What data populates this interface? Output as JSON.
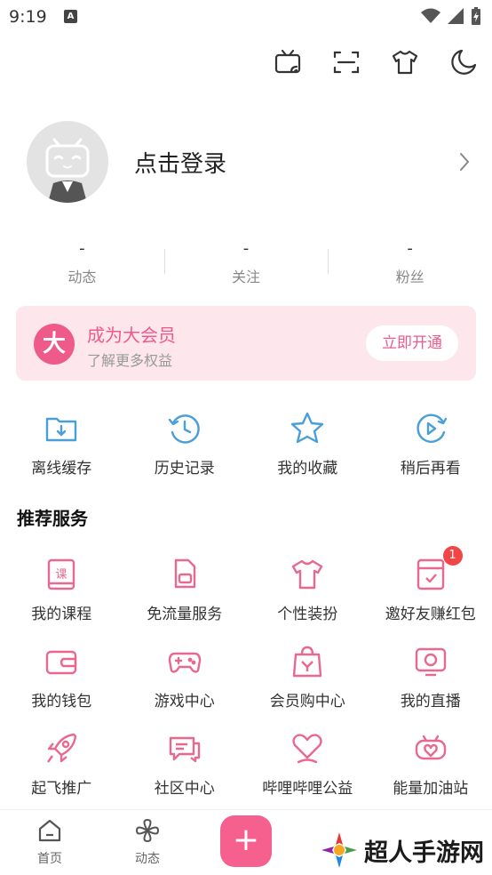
{
  "status_bar": {
    "time": "9:19",
    "notification_letter": "A",
    "icons": [
      "wifi-icon",
      "signal-icon",
      "battery-charging-icon"
    ]
  },
  "top_actions": [
    "tv-cast-icon",
    "scan-icon",
    "theme-shirt-icon",
    "night-mode-icon"
  ],
  "profile": {
    "login_text": "点击登录"
  },
  "stats": [
    {
      "value": "-",
      "label": "动态"
    },
    {
      "value": "-",
      "label": "关注"
    },
    {
      "value": "-",
      "label": "粉丝"
    }
  ],
  "vip": {
    "badge": "大",
    "title": "成为大会员",
    "subtitle": "了解更多权益",
    "button": "立即开通"
  },
  "quick_actions": [
    {
      "label": "离线缓存",
      "icon": "offline-cache-icon"
    },
    {
      "label": "历史记录",
      "icon": "history-icon"
    },
    {
      "label": "我的收藏",
      "icon": "favorite-star-icon"
    },
    {
      "label": "稍后再看",
      "icon": "watch-later-icon"
    }
  ],
  "section_title": "推荐服务",
  "services": [
    {
      "label": "我的课程",
      "icon": "course-icon"
    },
    {
      "label": "免流量服务",
      "icon": "free-data-icon"
    },
    {
      "label": "个性装扮",
      "icon": "dress-up-icon"
    },
    {
      "label": "邀好友赚红包",
      "icon": "invite-red-packet-icon",
      "badge": "1"
    },
    {
      "label": "我的钱包",
      "icon": "wallet-icon"
    },
    {
      "label": "游戏中心",
      "icon": "game-center-icon"
    },
    {
      "label": "会员购中心",
      "icon": "shopping-bag-icon"
    },
    {
      "label": "我的直播",
      "icon": "live-icon"
    },
    {
      "label": "起飞推广",
      "icon": "rocket-icon"
    },
    {
      "label": "社区中心",
      "icon": "community-chat-icon"
    },
    {
      "label": "哔哩哔哩公益",
      "icon": "charity-heart-icon"
    },
    {
      "label": "能量加油站",
      "icon": "energy-station-icon"
    }
  ],
  "bottom_nav": [
    {
      "label": "首页",
      "icon": "home-icon"
    },
    {
      "label": "动态",
      "icon": "dynamic-pinwheel-icon"
    }
  ],
  "add_button": "+",
  "watermark": {
    "text": "超人手游网"
  },
  "colors": {
    "accent_pink": "#ef5b88",
    "icon_blue": "#4a9fd8",
    "icon_pink": "#e9688f",
    "badge_red": "#f24545"
  }
}
